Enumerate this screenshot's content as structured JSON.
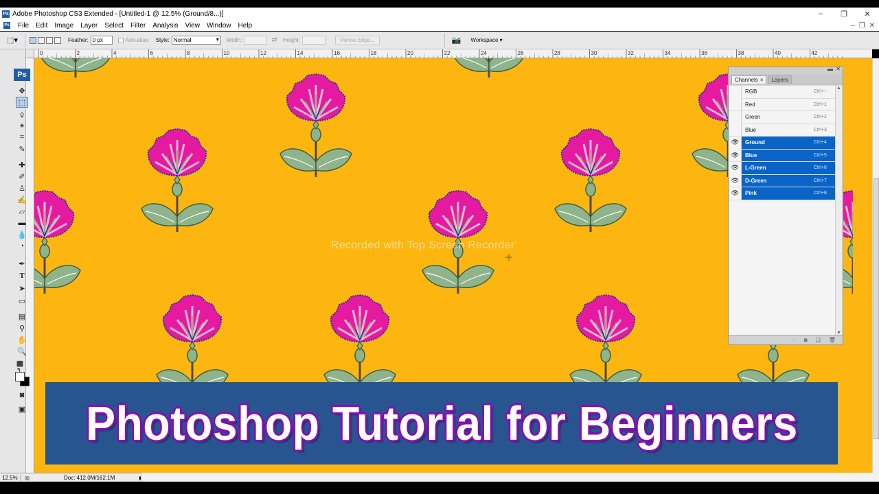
{
  "window": {
    "title": "Adobe Photoshop CS3 Extended - [Untitled-1 @ 12.5% (Ground/8...)]",
    "min": "‒",
    "max": "❐",
    "close": "✕"
  },
  "menu": [
    "File",
    "Edit",
    "Image",
    "Layer",
    "Select",
    "Filter",
    "Analysis",
    "View",
    "Window",
    "Help"
  ],
  "doc_controls": [
    "‒",
    "❐",
    "✕"
  ],
  "options": {
    "feather_label": "Feather:",
    "feather_value": "0 px",
    "antialias_label": "Anti-alias",
    "style_label": "Style:",
    "style_value": "Normal",
    "width_label": "Width:",
    "height_label": "Height:",
    "refine_edge": "Refine Edge...",
    "workspace": "Workspace ▾"
  },
  "ruler_ticks": [
    "0",
    "2",
    "4",
    "6",
    "8",
    "10",
    "12",
    "14",
    "16",
    "18",
    "20",
    "22",
    "24",
    "26",
    "28",
    "30",
    "32",
    "34",
    "36",
    "38",
    "40",
    "42"
  ],
  "toolbox": {
    "logo": "Ps",
    "tools": [
      "move-tool",
      "marquee-tool",
      "lasso-tool",
      "magic-wand-tool",
      "crop-tool",
      "slice-tool",
      "healing-tool",
      "brush-tool",
      "clone-stamp-tool",
      "history-brush-tool",
      "eraser-tool",
      "gradient-tool",
      "blur-tool",
      "dodge-tool",
      "pen-tool",
      "type-tool",
      "path-select-tool",
      "shape-tool",
      "notes-tool",
      "eyedropper-tool",
      "hand-tool",
      "zoom-tool"
    ]
  },
  "canvas": {
    "background": "#fdb60f",
    "watermark": "Recorded with Top Screen Recorder"
  },
  "banner": {
    "text": "Photoshop Tutorial for Beginners",
    "background": "#28548f",
    "outline": "#8a0ab5"
  },
  "channels_panel": {
    "tabs": [
      {
        "label": "Channels",
        "active": true
      },
      {
        "label": "Layers",
        "active": false
      }
    ],
    "rows": [
      {
        "name": "RGB",
        "shortcut": "Ctrl+~",
        "visible": false,
        "selected": false
      },
      {
        "name": "Red",
        "shortcut": "Ctrl+1",
        "visible": false,
        "selected": false
      },
      {
        "name": "Green",
        "shortcut": "Ctrl+2",
        "visible": false,
        "selected": false
      },
      {
        "name": "Blue",
        "shortcut": "Ctrl+3",
        "visible": false,
        "selected": false
      },
      {
        "name": "Ground",
        "shortcut": "Ctrl+4",
        "visible": true,
        "selected": true
      },
      {
        "name": "Blue",
        "shortcut": "Ctrl+5",
        "visible": true,
        "selected": true
      },
      {
        "name": "L-Green",
        "shortcut": "Ctrl+6",
        "visible": true,
        "selected": true
      },
      {
        "name": "D-Green",
        "shortcut": "Ctrl+7",
        "visible": true,
        "selected": true
      },
      {
        "name": "Pink",
        "shortcut": "Ctrl+8",
        "visible": true,
        "selected": true
      }
    ],
    "selection_color": "#0a64c8"
  },
  "status": {
    "zoom": "12.5%",
    "doc": "Doc: 412.0M/162.1M",
    "arrow": "▶"
  }
}
